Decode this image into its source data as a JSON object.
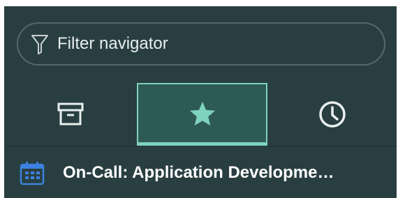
{
  "filter": {
    "placeholder": "Filter navigator",
    "icon": "filter-icon"
  },
  "tabs": [
    {
      "name": "all-applications",
      "icon": "archive-box-icon",
      "selected": false
    },
    {
      "name": "favorites",
      "icon": "star-icon",
      "selected": true
    },
    {
      "name": "history",
      "icon": "clock-icon",
      "selected": false
    }
  ],
  "favorites": {
    "items": [
      {
        "label": "On-Call: Application Developme…",
        "icon": "calendar-icon"
      }
    ]
  },
  "colors": {
    "background": "#293e40",
    "accent": "#7ed3bc",
    "selected_tab": "#2e5a55",
    "calendar_icon": "#3b82e0"
  }
}
